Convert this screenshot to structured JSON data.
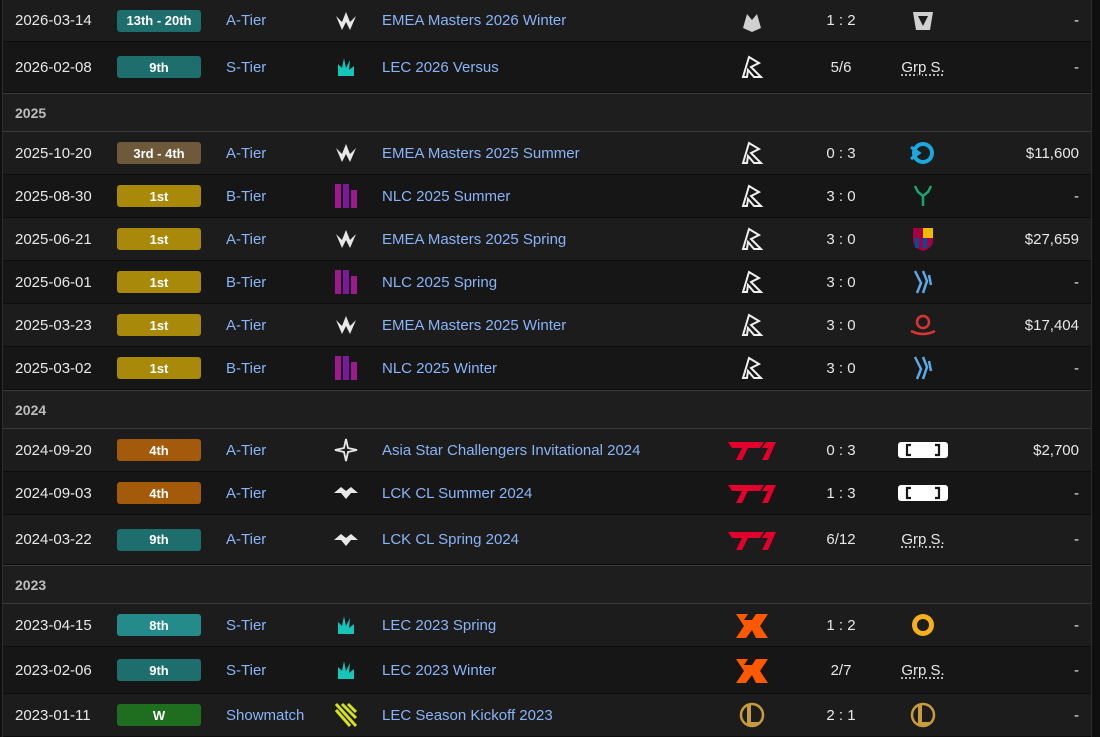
{
  "colors": {
    "place_top8": "#1f6e6e",
    "place_9th": "#1f6e6e",
    "place_8th": "#258a8a",
    "place_3rd4th": "#6e5a3a",
    "place_1st": "#a8890a",
    "place_4th": "#a35a0a",
    "place_win": "#1f6e1f",
    "link": "#8ab4f8"
  },
  "years": [
    "2025",
    "2024",
    "2023"
  ],
  "rows": [
    {
      "date": "2026-03-14",
      "place": "13th - 20th",
      "tier": "A-Tier",
      "tournament": "EMEA Masters 2026 Winter",
      "score": "1 : 2",
      "opponent_text": "",
      "prize": "-",
      "tlogo": "emea-masters-icon",
      "team": "team-logo-icon",
      "opp": "opponent-logo-icon"
    },
    {
      "date": "2026-02-08",
      "place": "9th",
      "tier": "S-Tier",
      "tournament": "LEC 2026 Versus",
      "score": "5/6",
      "opponent_text": "Grp S.",
      "prize": "-",
      "tlogo": "lec-icon",
      "team": "los-ratones-logo-icon",
      "opp": ""
    },
    {
      "date": "2025-10-20",
      "place": "3rd - 4th",
      "tier": "A-Tier",
      "tournament": "EMEA Masters 2025 Summer",
      "score": "0 : 3",
      "opponent_text": "",
      "prize": "$11,600",
      "tlogo": "emea-masters-icon",
      "team": "los-ratones-logo-icon",
      "opp": "karmine-logo-icon"
    },
    {
      "date": "2025-08-30",
      "place": "1st",
      "tier": "B-Tier",
      "tournament": "NLC 2025 Summer",
      "score": "3 : 0",
      "opponent_text": "",
      "prize": "-",
      "tlogo": "nlc-icon",
      "team": "los-ratones-logo-icon",
      "opp": "stag-logo-icon"
    },
    {
      "date": "2025-06-21",
      "place": "1st",
      "tier": "A-Tier",
      "tournament": "EMEA Masters 2025 Spring",
      "score": "3 : 0",
      "opponent_text": "",
      "prize": "$27,659",
      "tlogo": "emea-masters-icon",
      "team": "los-ratones-logo-icon",
      "opp": "barca-logo-icon"
    },
    {
      "date": "2025-06-01",
      "place": "1st",
      "tier": "B-Tier",
      "tournament": "NLC 2025 Spring",
      "score": "3 : 0",
      "opponent_text": "",
      "prize": "-",
      "tlogo": "nlc-icon",
      "team": "los-ratones-logo-icon",
      "opp": "wing-logo-icon"
    },
    {
      "date": "2025-03-23",
      "place": "1st",
      "tier": "A-Tier",
      "tournament": "EMEA Masters 2025 Winter",
      "score": "3 : 0",
      "opponent_text": "",
      "prize": "$17,404",
      "tlogo": "emea-masters-icon",
      "team": "los-ratones-logo-icon",
      "opp": "octopus-logo-icon"
    },
    {
      "date": "2025-03-02",
      "place": "1st",
      "tier": "B-Tier",
      "tournament": "NLC 2025 Winter",
      "score": "3 : 0",
      "opponent_text": "",
      "prize": "-",
      "tlogo": "nlc-icon",
      "team": "los-ratones-logo-icon",
      "opp": "wing-logo-icon"
    },
    {
      "date": "2024-09-20",
      "place": "4th",
      "tier": "A-Tier",
      "tournament": "Asia Star Challengers Invitational 2024",
      "score": "0 : 3",
      "opponent_text": "",
      "prize": "$2,700",
      "tlogo": "star-icon",
      "team": "t1-logo-icon",
      "opp": "bracket-logo-icon"
    },
    {
      "date": "2024-09-03",
      "place": "4th",
      "tier": "A-Tier",
      "tournament": "LCK CL Summer 2024",
      "score": "1 : 3",
      "opponent_text": "",
      "prize": "-",
      "tlogo": "lck-icon",
      "team": "t1-logo-icon",
      "opp": "bracket-logo-icon"
    },
    {
      "date": "2024-03-22",
      "place": "9th",
      "tier": "A-Tier",
      "tournament": "LCK CL Spring 2024",
      "score": "6/12",
      "opponent_text": "Grp S.",
      "prize": "-",
      "tlogo": "lck-icon",
      "team": "t1-logo-icon",
      "opp": ""
    },
    {
      "date": "2023-04-15",
      "place": "8th",
      "tier": "S-Tier",
      "tournament": "LEC 2023 Spring",
      "score": "1 : 2",
      "opponent_text": "",
      "prize": "-",
      "tlogo": "lec-icon",
      "team": "fnatic-logo-icon",
      "opp": "mad-lions-logo-icon"
    },
    {
      "date": "2023-02-06",
      "place": "9th",
      "tier": "S-Tier",
      "tournament": "LEC 2023 Winter",
      "score": "2/7",
      "opponent_text": "Grp S.",
      "prize": "-",
      "tlogo": "lec-icon",
      "team": "fnatic-logo-icon",
      "opp": ""
    },
    {
      "date": "2023-01-11",
      "place": "W",
      "tier": "Showmatch",
      "tournament": "LEC Season Kickoff 2023",
      "score": "2 : 1",
      "opponent_text": "",
      "prize": "-",
      "tlogo": "lec-kickoff-icon",
      "team": "lol-logo-icon",
      "opp": "lol-logo-icon"
    }
  ]
}
